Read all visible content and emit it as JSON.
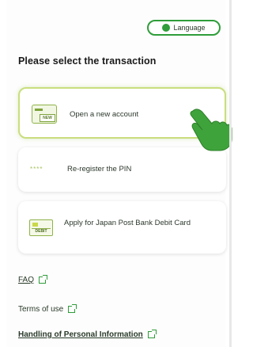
{
  "header": {
    "language_label": "Language"
  },
  "main": {
    "title": "Please select the transaction",
    "options": [
      {
        "label": "Open a new account",
        "icon": "new-account-icon",
        "icon_tag": "NEW",
        "selected": true
      },
      {
        "label": "Re-register the PIN",
        "icon": "pin-dots-icon",
        "icon_glyph": "****",
        "selected": false
      },
      {
        "label": "Apply for Japan Post Bank Debit Card",
        "icon": "debit-card-icon",
        "icon_tag": "DEBIT",
        "selected": false
      }
    ]
  },
  "links": [
    {
      "label": "FAQ"
    },
    {
      "label": "Terms of use"
    },
    {
      "label": "Handling of Personal Information"
    }
  ],
  "colors": {
    "accent": "#2f9d3a",
    "selected_border": "#c9de7e"
  }
}
